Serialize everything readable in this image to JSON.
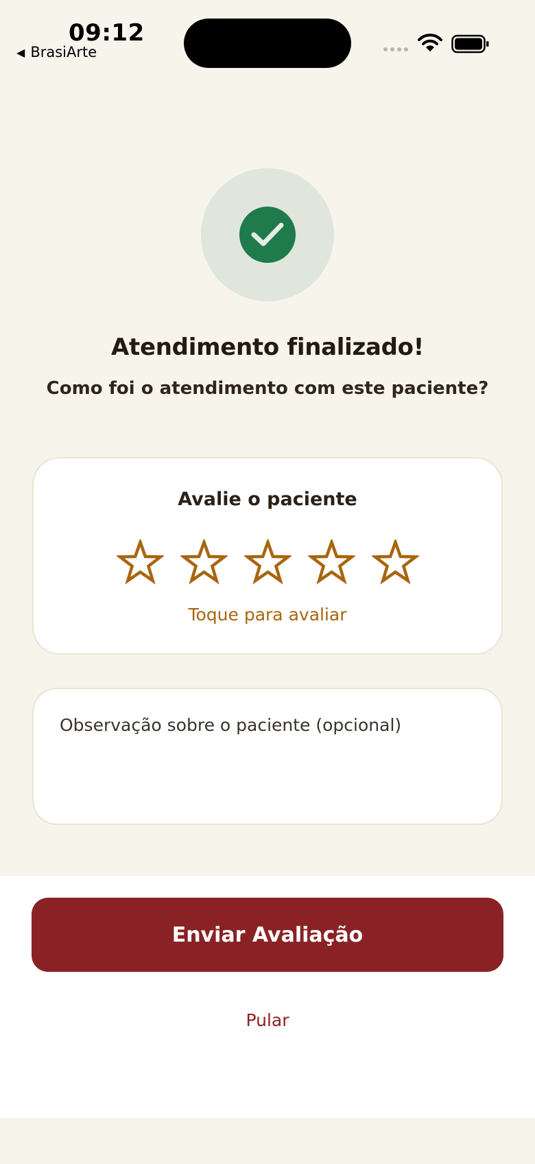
{
  "status_bar": {
    "time": "09:12",
    "back_app": "BrasiArte",
    "back_glyph": "◀"
  },
  "success": {
    "icon": "check-icon",
    "title": "Atendimento finalizado!",
    "subtitle": "Como foi o atendimento com este paciente?"
  },
  "rating": {
    "title": "Avalie o paciente",
    "max_stars": 5,
    "selected": 0,
    "hint": "Toque para avaliar",
    "star_color": "#a8650f"
  },
  "notes": {
    "placeholder": "Observação sobre o paciente (opcional)",
    "value": ""
  },
  "actions": {
    "submit_label": "Enviar Avaliação",
    "skip_label": "Pular"
  },
  "colors": {
    "background": "#f7f4ec",
    "primary": "#8a2225",
    "success": "#1f7a4c",
    "accent": "#a8650f"
  }
}
